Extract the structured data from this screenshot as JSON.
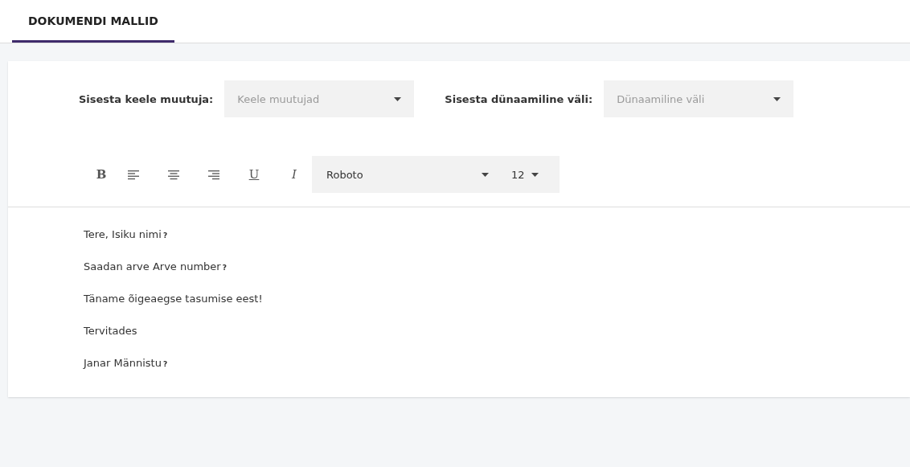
{
  "tabs": [
    {
      "label": "DOKUMENDI MALLID",
      "selected": true
    }
  ],
  "fields": [
    {
      "label": "Sisesta keele muutuja:",
      "placeholder": "Keele muutujad"
    },
    {
      "label": "Sisesta dünaamiline väli:",
      "placeholder": "Dünaamiline väli"
    }
  ],
  "toolbar": [
    {
      "kind": "bold",
      "label": "B"
    },
    {
      "kind": "left"
    },
    {
      "kind": "center"
    },
    {
      "kind": "right"
    },
    {
      "kind": "underline",
      "label": "U"
    },
    {
      "kind": "italic",
      "label": "I"
    }
  ],
  "font_select": {
    "value": "Roboto"
  },
  "size_select": {
    "value": "12"
  },
  "lines": [
    {
      "text": "Tere, Isiku nimi",
      "marker": "?"
    },
    {
      "text": "Saadan arve Arve number",
      "marker": "?"
    },
    {
      "text": "Täname õigeaegse tasumise eest!"
    },
    {
      "text": "Tervitades"
    },
    {
      "text": "Janar Männistu",
      "marker": "?"
    }
  ]
}
